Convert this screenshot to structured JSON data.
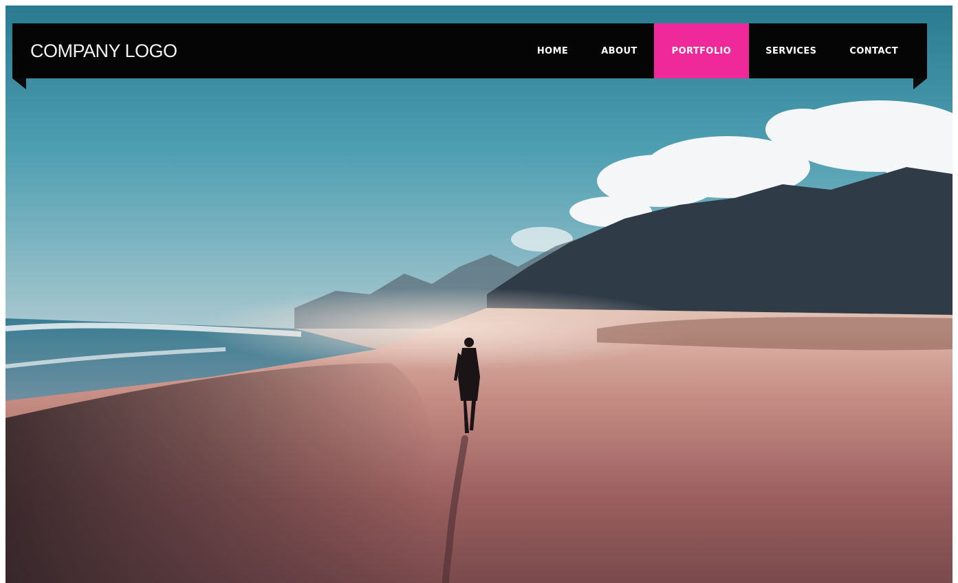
{
  "header": {
    "logo": "COMPANY LOGO",
    "nav_items": [
      {
        "label": "HOME",
        "active": false
      },
      {
        "label": "ABOUT",
        "active": false
      },
      {
        "label": "PORTFOLIO",
        "active": true
      },
      {
        "label": "SERVICES",
        "active": false
      },
      {
        "label": "CONTACT",
        "active": false
      }
    ]
  },
  "colors": {
    "navbar_background": "#050505",
    "active_accent": "#f0299a",
    "nav_text": "#ffffff"
  }
}
